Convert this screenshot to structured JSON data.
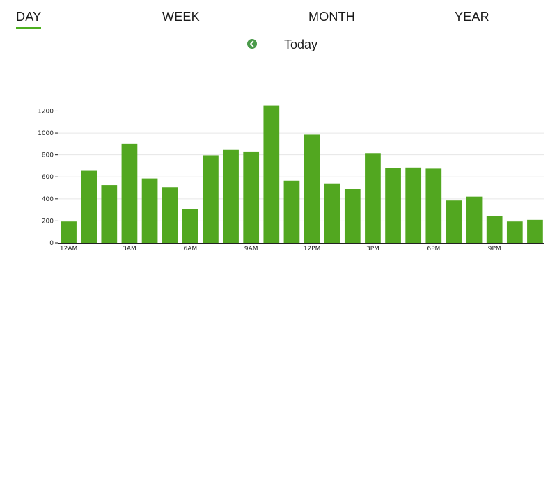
{
  "tabs": [
    {
      "label": "DAY",
      "active": true
    },
    {
      "label": "WEEK",
      "active": false
    },
    {
      "label": "MONTH",
      "active": false
    },
    {
      "label": "YEAR",
      "active": false
    }
  ],
  "nav": {
    "prev_icon": "chevron-left-circle-icon",
    "period_label": "Today"
  },
  "colors": {
    "accent": "#4caf1f",
    "bar": "#52a720",
    "prev_icon": "#4a9a4a",
    "grid": "#e6e6e6",
    "axis": "#222222"
  },
  "chart_data": {
    "type": "bar",
    "categories": [
      "12AM",
      "1AM",
      "2AM",
      "3AM",
      "4AM",
      "5AM",
      "6AM",
      "7AM",
      "8AM",
      "9AM",
      "10AM",
      "11AM",
      "12PM",
      "1PM",
      "2PM",
      "3PM",
      "4PM",
      "5PM",
      "6PM",
      "7PM",
      "8PM",
      "9PM",
      "10PM",
      "11PM"
    ],
    "values": [
      195,
      655,
      525,
      900,
      585,
      505,
      305,
      795,
      850,
      830,
      1250,
      565,
      985,
      540,
      490,
      815,
      680,
      685,
      675,
      385,
      420,
      245,
      195,
      210
    ],
    "x_tick_labels": [
      "12AM",
      "3AM",
      "6AM",
      "9AM",
      "12PM",
      "3PM",
      "6PM",
      "9PM"
    ],
    "x_tick_every": 3,
    "y_ticks": [
      0,
      200,
      400,
      600,
      800,
      1000,
      1200
    ],
    "ylim": [
      0,
      1260
    ],
    "grid": true,
    "legend": "none",
    "title": "",
    "xlabel": "",
    "ylabel": ""
  }
}
